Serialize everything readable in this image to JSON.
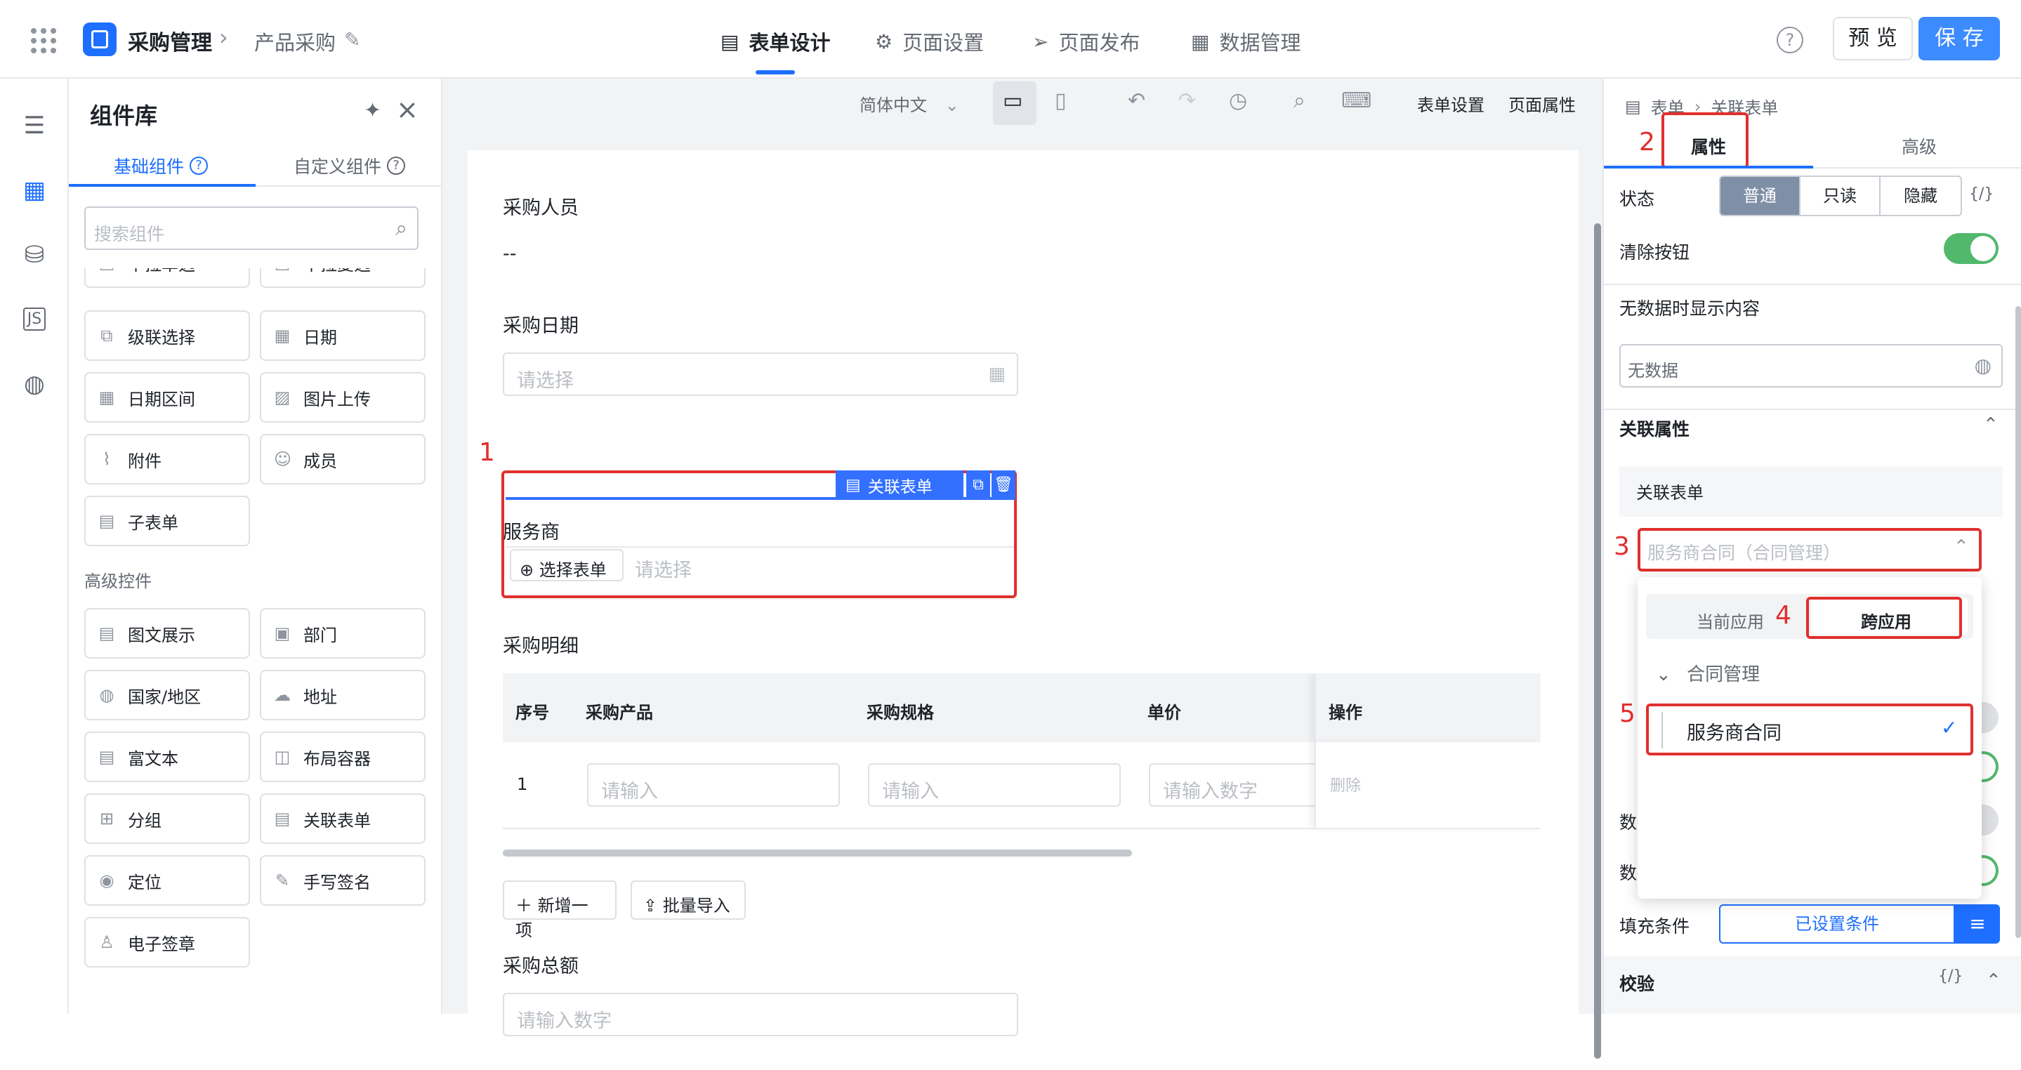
{
  "header": {
    "app_name": "采购管理",
    "breadcrumb_sep": "›",
    "page_name": "产品采购",
    "tabs": [
      {
        "label": "表单设计",
        "icon": "document-icon",
        "active": true
      },
      {
        "label": "页面设置",
        "icon": "gear-icon",
        "active": false
      },
      {
        "label": "页面发布",
        "icon": "send-icon",
        "active": false
      },
      {
        "label": "数据管理",
        "icon": "table-icon",
        "active": false
      }
    ],
    "help": "?",
    "preview_label": "预 览",
    "save_label": "保 存",
    "accent": "#1e6fff"
  },
  "component_panel": {
    "title": "组件库",
    "tab_basic": "基础组件",
    "tab_custom": "自定义组件",
    "search_placeholder": "搜索组件",
    "partial_items": [
      "下拉单选",
      "下拉复选"
    ],
    "basic_items": [
      {
        "label": "级联选择",
        "icon": "cascade-icon"
      },
      {
        "label": "日期",
        "icon": "calendar-icon"
      },
      {
        "label": "日期区间",
        "icon": "calendar-range-icon"
      },
      {
        "label": "图片上传",
        "icon": "image-icon"
      },
      {
        "label": "附件",
        "icon": "paperclip-icon"
      },
      {
        "label": "成员",
        "icon": "user-icon"
      },
      {
        "label": "子表单",
        "icon": "subform-icon"
      }
    ],
    "advanced_title": "高级控件",
    "advanced_items": [
      {
        "label": "图文展示",
        "icon": "richtext-icon"
      },
      {
        "label": "部门",
        "icon": "department-icon"
      },
      {
        "label": "国家/地区",
        "icon": "globe-icon"
      },
      {
        "label": "地址",
        "icon": "map-icon"
      },
      {
        "label": "富文本",
        "icon": "text-icon"
      },
      {
        "label": "布局容器",
        "icon": "layout-icon"
      },
      {
        "label": "分组",
        "icon": "group-icon"
      },
      {
        "label": "关联表单",
        "icon": "linked-form-icon"
      },
      {
        "label": "定位",
        "icon": "location-icon"
      },
      {
        "label": "手写签名",
        "icon": "pen-icon"
      },
      {
        "label": "电子签章",
        "icon": "stamp-icon"
      }
    ]
  },
  "toolbar": {
    "language": "简体中文",
    "form_settings": "表单设置",
    "page_props": "页面属性"
  },
  "form": {
    "field1_label": "采购人员",
    "field1_value": "--",
    "field2_label": "采购日期",
    "field2_placeholder": "请选择",
    "selected_tag": "关联表单",
    "field3_label": "服务商",
    "choose_form_btn": "选择表单",
    "field3_placeholder": "请选择",
    "detail_label": "采购明细",
    "columns": [
      "序号",
      "采购产品",
      "采购规格",
      "单价",
      "操作"
    ],
    "row": {
      "index": "1",
      "product_placeholder": "请输入",
      "spec_placeholder": "请输入",
      "price_placeholder": "请输入数字",
      "delete": "删除"
    },
    "add_row": "新增一项",
    "bulk_import": "批量导入",
    "total_label": "采购总额",
    "total_placeholder": "请输入数字"
  },
  "annotations": [
    "1",
    "2",
    "3",
    "4",
    "5"
  ],
  "props_panel": {
    "crumb1": "表单",
    "crumb2": "关联表单",
    "tab_props": "属性",
    "tab_advanced": "高级",
    "state_label": "状态",
    "state_options": [
      "普通",
      "只读",
      "隐藏"
    ],
    "state_selected": "普通",
    "code_icon": "{/}",
    "clear_btn_label": "清除按钮",
    "clear_btn_on": true,
    "empty_text_label": "无数据时显示内容",
    "empty_text_value": "无数据",
    "link_section": "关联属性",
    "link_form_label": "关联表单",
    "link_form_value": "服务商合同（合同管理）",
    "dd_tab_current": "当前应用",
    "dd_tab_cross": "跨应用",
    "dd_group": "合同管理",
    "dd_item": "服务商合同",
    "filter_label": "数据筛选",
    "fill_label": "数据填充",
    "fill_on": true,
    "fill_cond_label": "填充条件",
    "fill_cond_btn": "已设置条件",
    "validate_label": "校验"
  }
}
